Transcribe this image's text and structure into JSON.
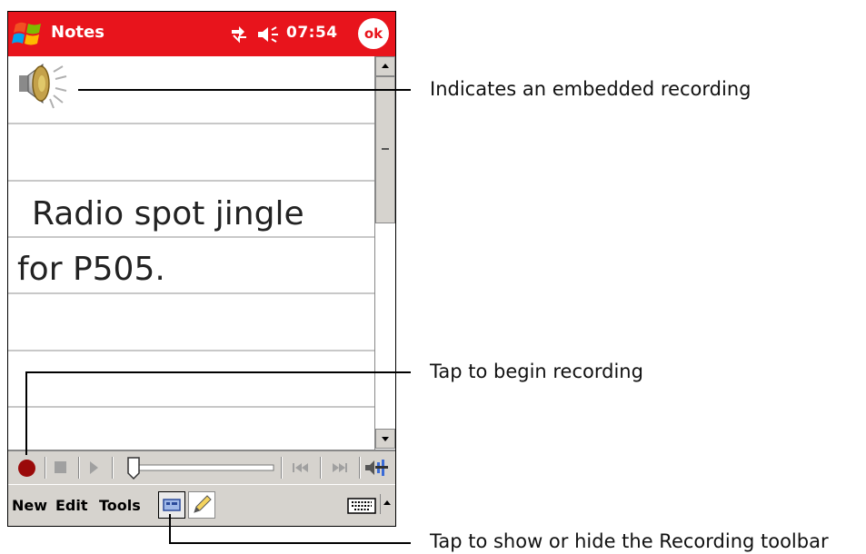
{
  "titlebar": {
    "app_title": "Notes",
    "time": "07:54",
    "ok_label": "ok"
  },
  "note": {
    "line1": "Radio spot jingle",
    "line2": "for P505."
  },
  "menu": {
    "new": "New",
    "edit": "Edit",
    "tools": "Tools"
  },
  "callouts": {
    "embedded": "Indicates an embedded recording",
    "begin": "Tap to begin recording",
    "toggle": "Tap to show or hide the Recording toolbar"
  },
  "colors": {
    "titlebar_bg": "#e8141c",
    "toolbar_bg": "#d6d3ce",
    "record_red": "#9a0a0a"
  },
  "icons": [
    "windows-start-icon",
    "connectivity-icon",
    "speaker-volume-icon",
    "embedded-recording-speaker-icon",
    "record-icon",
    "stop-icon",
    "play-icon",
    "rewind-icon",
    "fast-forward-icon",
    "volume-icon",
    "recording-toolbar-icon",
    "pen-icon",
    "keyboard-icon",
    "chevron-up-icon"
  ]
}
